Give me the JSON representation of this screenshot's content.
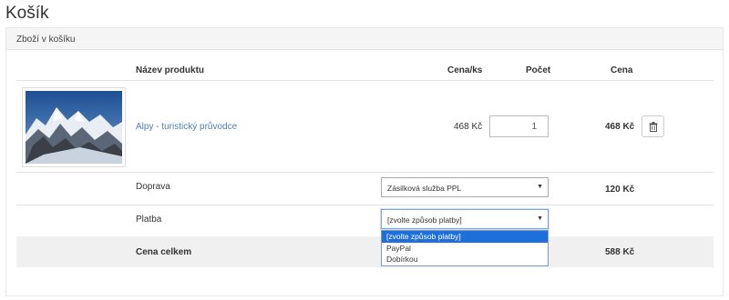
{
  "page": {
    "title": "Košík"
  },
  "panel": {
    "heading": "Zboží v košíku"
  },
  "table": {
    "headers": {
      "name": "Název produktu",
      "unit_price": "Cena/ks",
      "quantity": "Počet",
      "price": "Cena"
    }
  },
  "product": {
    "name": "Alpy - turistický průvodce",
    "unit_price": "468 Kč",
    "quantity": "1",
    "price": "468 Kč",
    "image_icon": "mountain-photo"
  },
  "shipping": {
    "label": "Doprava",
    "selected": "Zásilková služba PPL",
    "price": "120 Kč"
  },
  "payment": {
    "label": "Platba",
    "selected": "[zvolte způsob platby]",
    "options": [
      "[zvolte způsob platby]",
      "PayPal",
      "Dobírkou"
    ]
  },
  "total": {
    "label": "Cena celkem",
    "price": "588 Kč"
  },
  "colors": {
    "link": "#4f7fae",
    "highlight": "#1e6fd9",
    "band": "#f0f0f0"
  }
}
